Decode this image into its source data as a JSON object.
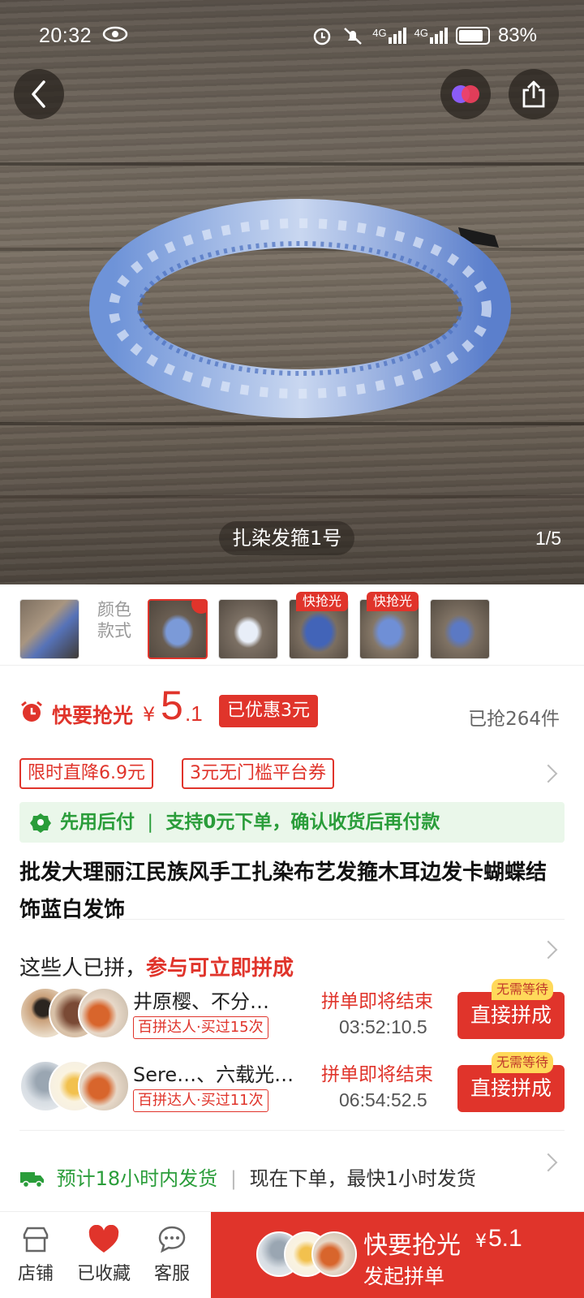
{
  "status_bar": {
    "time": "20:32",
    "net1": "4G",
    "net2": "4G",
    "battery": "83%"
  },
  "hero": {
    "caption": "扎染发箍1号",
    "counter": "1/5"
  },
  "variants": {
    "label": "颜色款式",
    "hot_tag": "快抢光"
  },
  "price": {
    "alarm_label": "快要抢光",
    "currency": "¥",
    "int": "5",
    "dec": ".1",
    "discount": "已优惠3元",
    "sold": "已抢264件"
  },
  "coupons": [
    "限时直降6.9元",
    "3元无门槛平台券"
  ],
  "pay_later": {
    "title": "先用后付",
    "text": "支持0元下单，确认收货后再付款"
  },
  "product_title": "批发大理丽江民族风手工扎染布艺发箍木耳边发卡蝴蝶结饰蓝白发饰",
  "group": {
    "head_prefix": "这些人已拼，",
    "head_accent": "参与可立即拼成",
    "items": [
      {
        "names": "井原樱、不分…",
        "badge": "百拼达人·买过15次",
        "status": "拼单即将结束",
        "time": "03:52:10.5",
        "btn": "直接拼成",
        "btn_tag": "无需等待"
      },
      {
        "names": "Sere…、六载光…",
        "badge": "百拼达人·买过11次",
        "status": "拼单即将结束",
        "time": "06:54:52.5",
        "btn": "直接拼成",
        "btn_tag": "无需等待"
      }
    ]
  },
  "shipping": {
    "title": "预计18小时内发货",
    "text": "现在下单，最快1小时发货"
  },
  "bottom_bar": {
    "store": "店铺",
    "fav": "已收藏",
    "service": "客服",
    "buy_label": "快要抢光",
    "buy_currency": "¥",
    "buy_price": "5.1",
    "buy_sub": "发起拼单"
  },
  "colors": {
    "accent": "#e0342b",
    "green": "#2a9d3a"
  }
}
